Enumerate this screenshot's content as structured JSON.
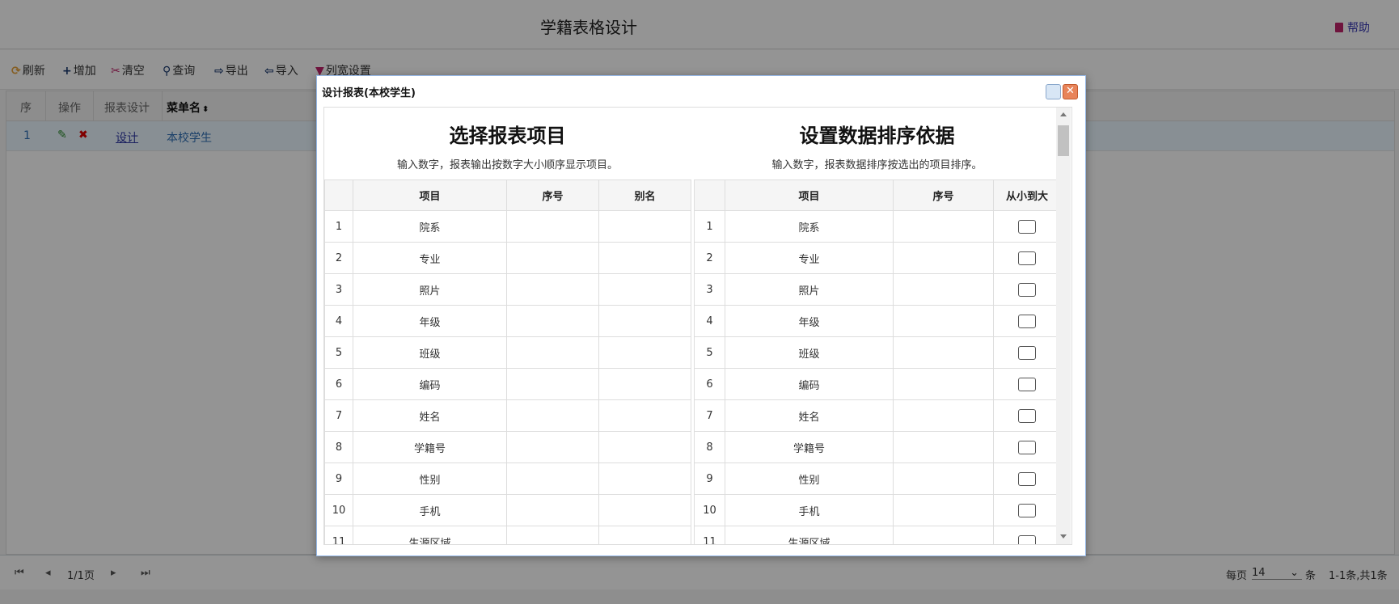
{
  "header": {
    "title": "学籍表格设计",
    "help_label": "帮助"
  },
  "toolbar": [
    {
      "icon": "refresh-icon",
      "label": "刷新",
      "glyph": "⟳",
      "color": "#e6a23c"
    },
    {
      "icon": "plus-icon",
      "label": "增加",
      "glyph": "+",
      "color": "#1a3a6e"
    },
    {
      "icon": "scissors-icon",
      "label": "清空",
      "glyph": "✂",
      "color": "#c0246a"
    },
    {
      "icon": "search-icon",
      "label": "查询",
      "glyph": "⚲",
      "color": "#1a3a6e"
    },
    {
      "icon": "export-icon",
      "label": "导出",
      "glyph": "⇨",
      "color": "#1a3a6e"
    },
    {
      "icon": "import-icon",
      "label": "导入",
      "glyph": "⇦",
      "color": "#1a3a6e"
    },
    {
      "icon": "pin-icon",
      "label": "列宽设置",
      "glyph": "▼",
      "color": "#c0246a"
    }
  ],
  "grid": {
    "columns": [
      "序",
      "操作",
      "报表设计",
      "菜单名"
    ],
    "sort_glyph": "⬍",
    "rows": [
      {
        "seq": "1",
        "design_link": "设计",
        "menu_name": "本校学生"
      }
    ]
  },
  "pager": {
    "page_info": "1/1页",
    "per_page_label": "每页",
    "per_page_value": "14",
    "unit": "条",
    "summary": "1-1条,共1条"
  },
  "dialog": {
    "title": "设计报表(本校学生)",
    "left": {
      "heading": "选择报表项目",
      "subtitle": "输入数字，报表输出按数字大小顺序显示项目。",
      "columns": [
        "",
        "项目",
        "序号",
        "别名"
      ]
    },
    "right": {
      "heading": "设置数据排序依据",
      "subtitle": "输入数字，报表数据排序按选出的项目排序。",
      "columns": [
        "",
        "项目",
        "序号",
        "从小到大"
      ]
    },
    "items": [
      "院系",
      "专业",
      "照片",
      "年级",
      "班级",
      "编码",
      "姓名",
      "学籍号",
      "性别",
      "手机",
      "生源区域"
    ]
  },
  "colors": {
    "link": "#2f6fb5",
    "accent": "#3b3bb5",
    "grid_row_bg": "#eaf6ff"
  }
}
